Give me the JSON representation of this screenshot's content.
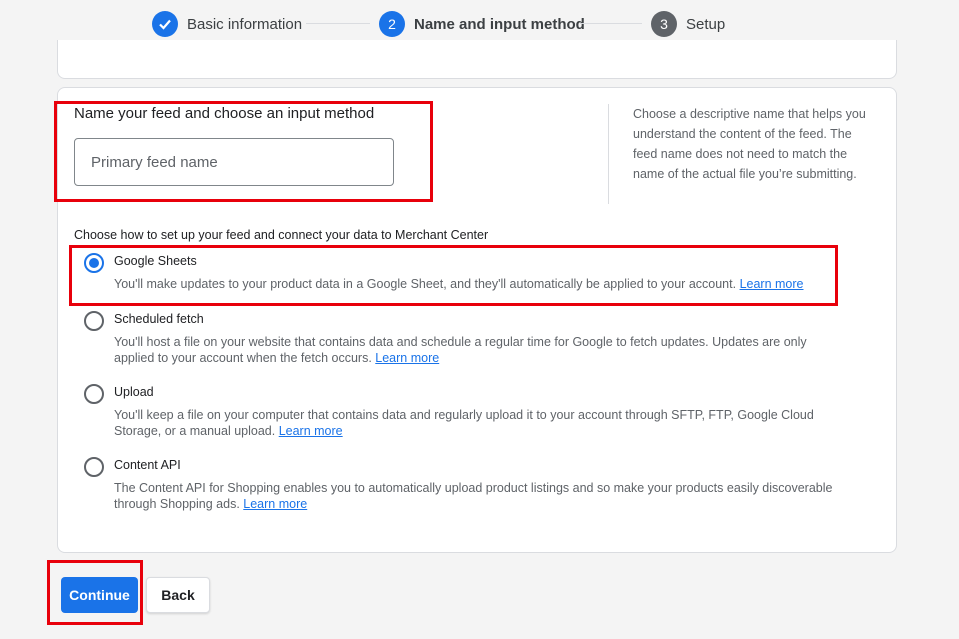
{
  "stepper": {
    "steps": [
      {
        "number": "",
        "label": "Basic information",
        "state": "done",
        "icon": "checkmark-icon"
      },
      {
        "number": "2",
        "label": "Name and input method",
        "state": "active"
      },
      {
        "number": "3",
        "label": "Setup",
        "state": "todo"
      }
    ]
  },
  "feed": {
    "title": "Name your feed and choose an input method",
    "input_placeholder": "Primary feed name",
    "input_value": "",
    "help_text": "Choose a descriptive name that helps you understand the content of the feed. The feed name does not need to match the name of the actual file you’re submitting."
  },
  "methods": {
    "label": "Choose how to set up your feed and connect your data to Merchant Center",
    "options": [
      {
        "title": "Google Sheets",
        "selected": true,
        "description": "You'll make updates to your product data in a Google Sheet, and they'll automatically be applied to your account.",
        "link": "Learn more"
      },
      {
        "title": "Scheduled fetch",
        "selected": false,
        "description": "You'll host a file on your website that contains data and schedule a regular time for Google to fetch updates. Updates are only applied to your account when the fetch occurs.",
        "link": "Learn more"
      },
      {
        "title": "Upload",
        "selected": false,
        "description": "You'll keep a file on your computer that contains data and regularly upload it to your account through SFTP, FTP, Google Cloud Storage, or a manual upload.",
        "link": "Learn more"
      },
      {
        "title": "Content API",
        "selected": false,
        "description": "The Content API for Shopping enables you to automatically upload product listings and so make your products easily discoverable through Shopping ads.",
        "link": "Learn more"
      }
    ]
  },
  "actions": {
    "continue_label": "Continue",
    "back_label": "Back"
  },
  "colors": {
    "accent": "#1a73e8",
    "highlight": "#e8000b"
  }
}
